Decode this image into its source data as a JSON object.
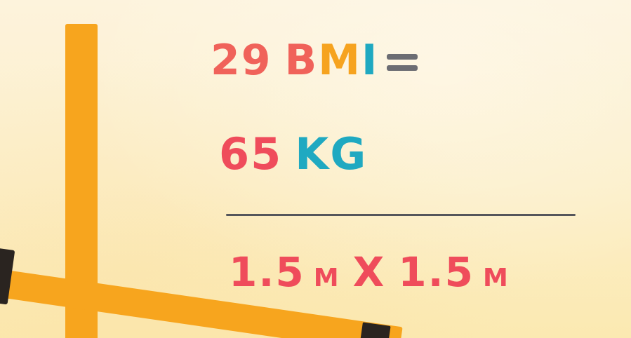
{
  "formula": {
    "bmi_value": "29",
    "bmi_letters": [
      "B",
      "M",
      "I"
    ],
    "equals": "=",
    "weight_value": "65",
    "weight_unit": "KG",
    "height_value_1": "1.5",
    "height_unit_1": "M",
    "multiply": "X",
    "height_value_2": "1.5",
    "height_unit_2": "M"
  },
  "colors": {
    "background": "#fcefc9",
    "orange_lines": "#f7a51e",
    "red_text": "#ef4c5b",
    "teal_text": "#1fa9c1",
    "grey_text": "#6c6d73",
    "fraction_line": "#55565b"
  }
}
